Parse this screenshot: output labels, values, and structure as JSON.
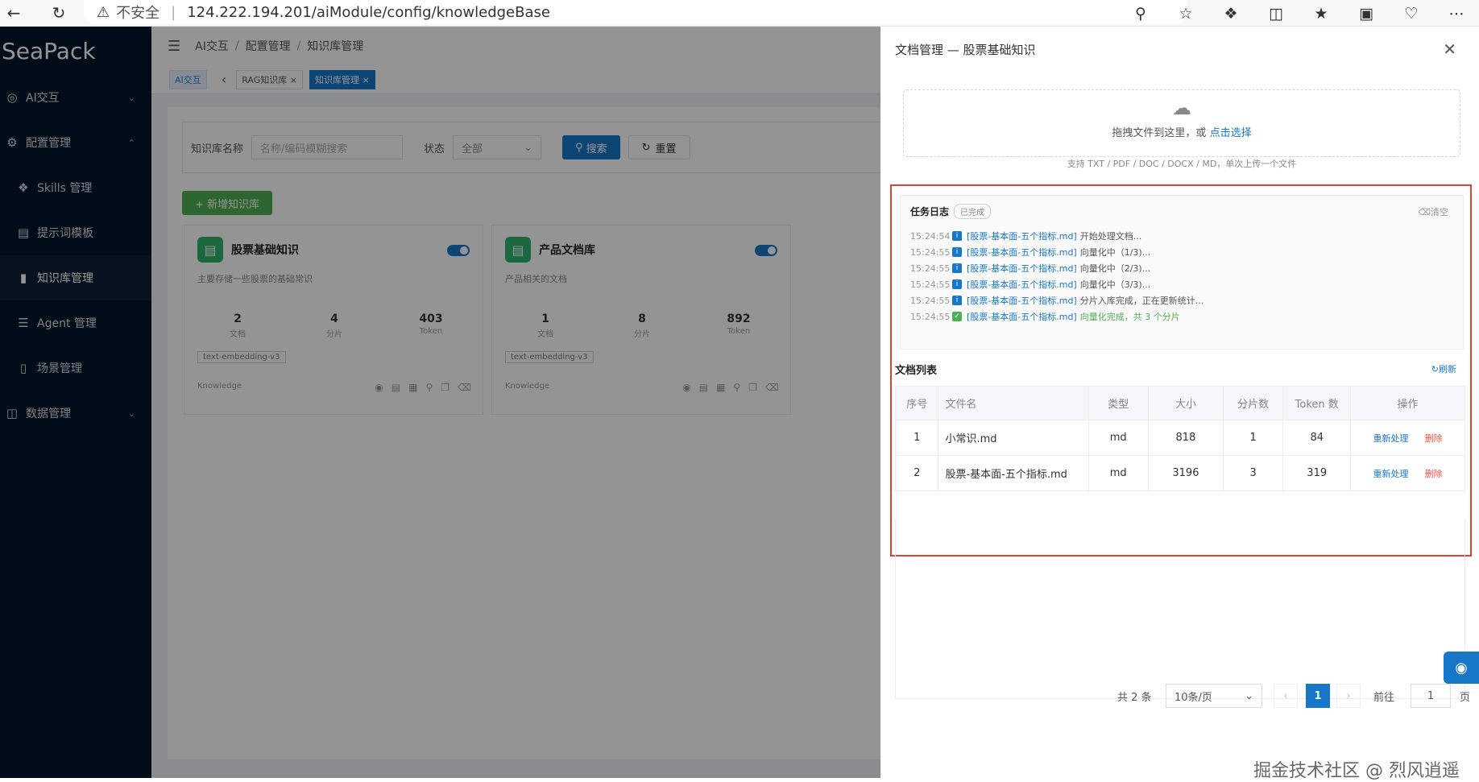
{
  "browser": {
    "back_icon": "back-arrow-icon",
    "reload_icon": "reload-icon",
    "insecure_label": "不安全",
    "url": "124.222.194.201/aiModule/config/knowledgeBase"
  },
  "sidebar": {
    "logo": "SeaPack",
    "items": [
      {
        "label": "AI交互",
        "icon": "robot-icon"
      },
      {
        "label": "配置管理",
        "icon": "gear-icon"
      },
      {
        "label": "Skills 管理",
        "icon": "puzzle-icon"
      },
      {
        "label": "提示词模板",
        "icon": "template-icon"
      },
      {
        "label": "知识库管理",
        "icon": "book-icon"
      },
      {
        "label": "Agent 管理",
        "icon": "list-icon"
      },
      {
        "label": "场景管理",
        "icon": "scene-icon"
      },
      {
        "label": "数据管理",
        "icon": "data-icon"
      }
    ]
  },
  "header": {
    "breadcrumb": [
      "AI交互",
      "配置管理",
      "知识库管理"
    ]
  },
  "tags": [
    {
      "label": "AI交互"
    },
    {
      "label": "RAG知识库 ×"
    },
    {
      "label": "知识库管理 ×"
    }
  ],
  "search": {
    "name_label": "知识库名称",
    "name_placeholder": "名称/编码模糊搜索",
    "status_label": "状态",
    "status_value": "全部",
    "search_button": "搜索",
    "reset_button": "重置",
    "add_button": "+ 新增知识库"
  },
  "cards": [
    {
      "title": "股票基础知识",
      "desc": "主要存储一些股票的基础常识",
      "stats": [
        {
          "n": "2",
          "l": "文档"
        },
        {
          "n": "4",
          "l": "分片"
        },
        {
          "n": "403",
          "l": "Token"
        }
      ],
      "model": "text-embedding-v3",
      "type": "Knowledge"
    },
    {
      "title": "产品文档库",
      "desc": "产品相关的文档",
      "stats": [
        {
          "n": "1",
          "l": "文档"
        },
        {
          "n": "8",
          "l": "分片"
        },
        {
          "n": "892",
          "l": "Token"
        }
      ],
      "model": "text-embedding-v3",
      "type": "Knowledge"
    }
  ],
  "drawer": {
    "title": "文档管理 — 股票基础知识",
    "upload_text": "拖拽文件到这里，或",
    "upload_link": "点击选择",
    "upload_hint": "支持 TXT / PDF / DOC / DOCX / MD，单次上传一个文件",
    "tasklog": {
      "title": "任务日志",
      "badge": "已完成",
      "clear": "清空",
      "lines": [
        {
          "time": "15:24:54",
          "file": "[股票-基本面-五个指标.md]",
          "msg": "开始处理文档...",
          "ok": false
        },
        {
          "time": "15:24:55",
          "file": "[股票-基本面-五个指标.md]",
          "msg": "向量化中（1/3)...",
          "ok": false
        },
        {
          "time": "15:24:55",
          "file": "[股票-基本面-五个指标.md]",
          "msg": "向量化中（2/3)...",
          "ok": false
        },
        {
          "time": "15:24:55",
          "file": "[股票-基本面-五个指标.md]",
          "msg": "向量化中（3/3)...",
          "ok": false
        },
        {
          "time": "15:24:55",
          "file": "[股票-基本面-五个指标.md]",
          "msg": "分片入库完成，正在更新统计...",
          "ok": false
        },
        {
          "time": "15:24:55",
          "file": "[股票-基本面-五个指标.md]",
          "msg": "向量化完成，共 3 个分片",
          "ok": true
        }
      ]
    },
    "doclist": {
      "title": "文档列表",
      "refresh": "刷新",
      "columns": [
        "序号",
        "文件名",
        "类型",
        "大小",
        "分片数",
        "Token 数",
        "操作"
      ],
      "rows": [
        {
          "idx": "1",
          "name": "小常识.md",
          "type": "md",
          "size": "818",
          "chunks": "1",
          "tokens": "84"
        },
        {
          "idx": "2",
          "name": "股票-基本面-五个指标.md",
          "type": "md",
          "size": "3196",
          "chunks": "3",
          "tokens": "319"
        }
      ],
      "op_reprocess": "重新处理",
      "op_delete": "删除"
    },
    "pager": {
      "total": "共 2 条",
      "size": "10条/页",
      "current": "1",
      "goto": "前往",
      "goto_value": "1",
      "unit": "页"
    }
  },
  "credit": "掘金技术社区 @ 烈风逍遥"
}
